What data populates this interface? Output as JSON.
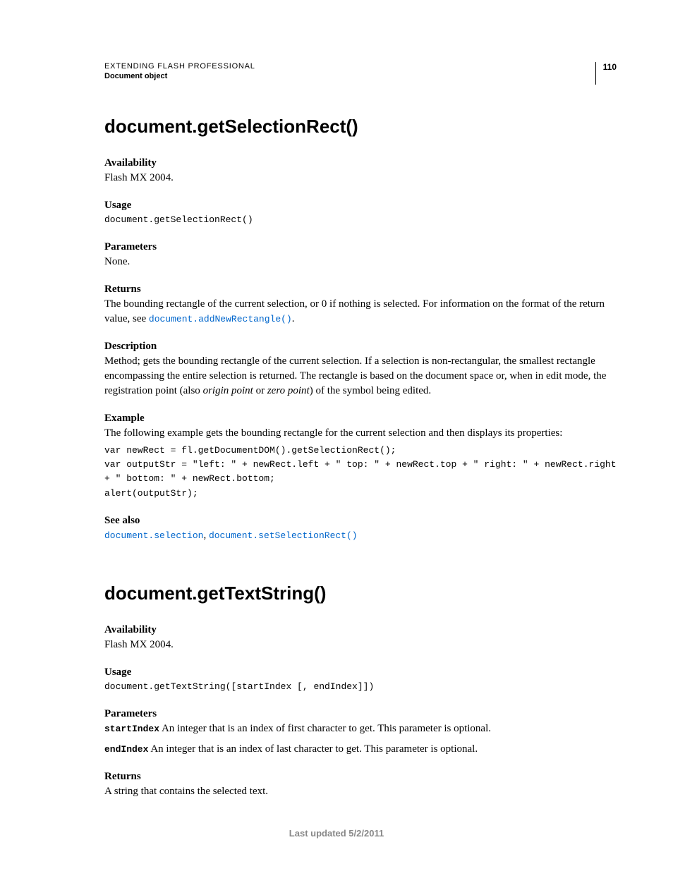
{
  "header": {
    "title": "EXTENDING FLASH PROFESSIONAL",
    "sub": "Document object",
    "page": "110"
  },
  "s1": {
    "title": "document.getSelectionRect()",
    "avail_h": "Availability",
    "avail_t": "Flash MX 2004.",
    "usage_h": "Usage",
    "usage_c": "document.getSelectionRect()",
    "params_h": "Parameters",
    "params_t": "None.",
    "returns_h": "Returns",
    "returns_t1": "The bounding rectangle of the current selection, or 0 if nothing is selected. For information on the format of the return value, see ",
    "returns_link": "document.addNewRectangle()",
    "returns_t2": ".",
    "desc_h": "Description",
    "desc_t1": "Method; gets the bounding rectangle of the current selection. If a selection is non-rectangular, the smallest rectangle encompassing the entire selection is returned. The rectangle is based on the document space or, when in edit mode, the registration point (also ",
    "desc_it1": "origin point",
    "desc_t2": " or ",
    "desc_it2": "zero point",
    "desc_t3": ") of the symbol being edited.",
    "ex_h": "Example",
    "ex_t": "The following example gets the bounding rectangle for the current selection and then displays its properties:",
    "ex_c": "var newRect = fl.getDocumentDOM().getSelectionRect();\nvar outputStr = \"left: \" + newRect.left + \" top: \" + newRect.top + \" right: \" + newRect.right\n+ \" bottom: \" + newRect.bottom;\nalert(outputStr);",
    "see_h": "See also",
    "see_l1": "document.selection",
    "see_sep": ", ",
    "see_l2": "document.setSelectionRect()"
  },
  "s2": {
    "title": "document.getTextString()",
    "avail_h": "Availability",
    "avail_t": "Flash MX 2004.",
    "usage_h": "Usage",
    "usage_c": "document.getTextString([startIndex [, endIndex]])",
    "params_h": "Parameters",
    "p1_name": "startIndex",
    "p1_t": "  An integer that is an index of first character to get. This parameter is optional.",
    "p2_name": "endIndex",
    "p2_t": "  An integer that is an index of last character to get. This parameter is optional.",
    "returns_h": "Returns",
    "returns_t": "A string that contains the selected text."
  },
  "footer": "Last updated 5/2/2011"
}
